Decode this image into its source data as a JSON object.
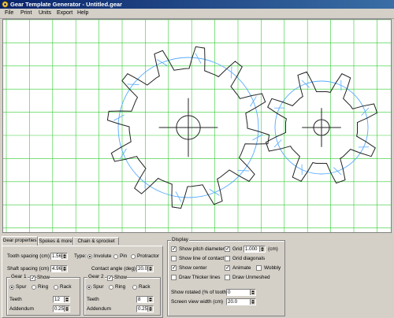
{
  "window": {
    "title": "Gear Template Generator - Untitled.gear"
  },
  "menu": {
    "items": [
      "File",
      "Print",
      "Units",
      "Export",
      "Help"
    ]
  },
  "tabs": [
    "Gear properties",
    "Spokes & more",
    "Chain & sprocket"
  ],
  "gear_properties": {
    "tooth_spacing_label": "Tooth spacing (cm)",
    "tooth_spacing_value": "1.560",
    "type_label": "Type:",
    "type_options": [
      "Involute",
      "Pin",
      "Protractor"
    ],
    "type_selected": "Involute",
    "shaft_spacing_label": "Shaft spacing (cm)",
    "shaft_spacing_value": "4.965",
    "contact_angle_label": "Contact angle (deg)",
    "contact_angle_value": "20.00",
    "gear1": {
      "title": "Gear 1",
      "show_label": "Show",
      "show_checked": true,
      "kind_options": [
        "Spur",
        "Ring",
        "Rack"
      ],
      "kind_selected": "Spur",
      "teeth_label": "Teeth",
      "teeth_value": "12",
      "addendum_label": "Addendum",
      "addendum_value": "0.250"
    },
    "gear2": {
      "title": "Gear 2",
      "show_label": "Show",
      "show_checked": true,
      "kind_options": [
        "Spur",
        "Ring",
        "Rack"
      ],
      "kind_selected": "Spur",
      "teeth_label": "Teeth",
      "teeth_value": "8",
      "addendum_label": "Addendum",
      "addendum_value": "0.250"
    }
  },
  "display": {
    "title": "Display",
    "show_pitch_diameter": {
      "label": "Show pitch diameter",
      "checked": true
    },
    "show_line_of_contact": {
      "label": "Show line of contact",
      "checked": false
    },
    "show_center": {
      "label": "Show center",
      "checked": true
    },
    "draw_thicker_lines": {
      "label": "Draw Thicker lines",
      "checked": false
    },
    "grid": {
      "label": "Grid",
      "checked": true,
      "value": "1.000",
      "unit": "(cm)"
    },
    "grid_diagonals": {
      "label": "Grid diagonals",
      "checked": false
    },
    "animate": {
      "label": "Animate",
      "checked": true
    },
    "wobbly": {
      "label": "Wobbly",
      "checked": false
    },
    "draw_unmeshed": {
      "label": "Draw Unmeshed",
      "checked": false
    },
    "show_rotated": {
      "label": "Show rotated (% of tooth)",
      "value": "0"
    },
    "screen_view_width": {
      "label": "Screen view width (cm)",
      "value": "20.0"
    }
  },
  "colors": {
    "grid": "#33cc33",
    "pitch": "#55aaff",
    "gear_outline": "#222222",
    "title_bar": "#0a246a"
  }
}
